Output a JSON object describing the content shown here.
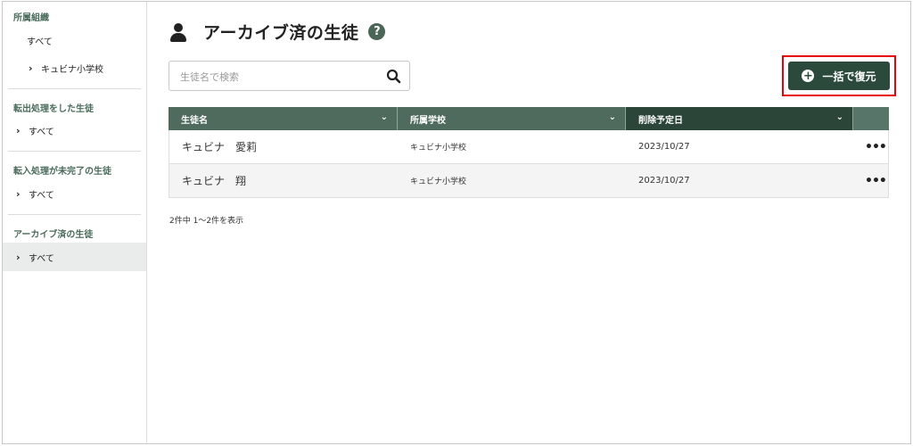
{
  "sidebar": {
    "sections": [
      {
        "title": "所属組織",
        "items": [
          {
            "label": "すべて"
          },
          {
            "label": "キュビナ小学校"
          }
        ]
      },
      {
        "title": "転出処理をした生徒",
        "items": [
          {
            "label": "すべて"
          }
        ]
      },
      {
        "title": "転入処理が未完了の生徒",
        "items": [
          {
            "label": "すべて"
          }
        ]
      },
      {
        "title": "アーカイブ済の生徒",
        "items": [
          {
            "label": "すべて"
          }
        ]
      }
    ],
    "active_item": "アーカイブ済の生徒/すべて"
  },
  "header": {
    "title": "アーカイブ済の生徒",
    "icon": "user-icon",
    "help_glyph": "?"
  },
  "search": {
    "placeholder": "生徒名で検索",
    "value": ""
  },
  "actions": {
    "restore_all_label": "一括で復元",
    "restore_icon_glyph": "+"
  },
  "table": {
    "columns": [
      "生徒名",
      "所属学校",
      "削除予定日"
    ],
    "rows": [
      {
        "name": "キュビナ　愛莉",
        "school": "キュビナ小学校",
        "date": "2023/10/27",
        "more": "•••"
      },
      {
        "name": "キュビナ　翔",
        "school": "キュビナ小学校",
        "date": "2023/10/27",
        "more": "•••"
      }
    ]
  },
  "footer": {
    "count_text": "2件中 1〜2件を表示"
  },
  "colors": {
    "accent_dark": "#2c4a3c",
    "header_green": "#4e6b5d",
    "highlight_red": "#e8000b"
  }
}
